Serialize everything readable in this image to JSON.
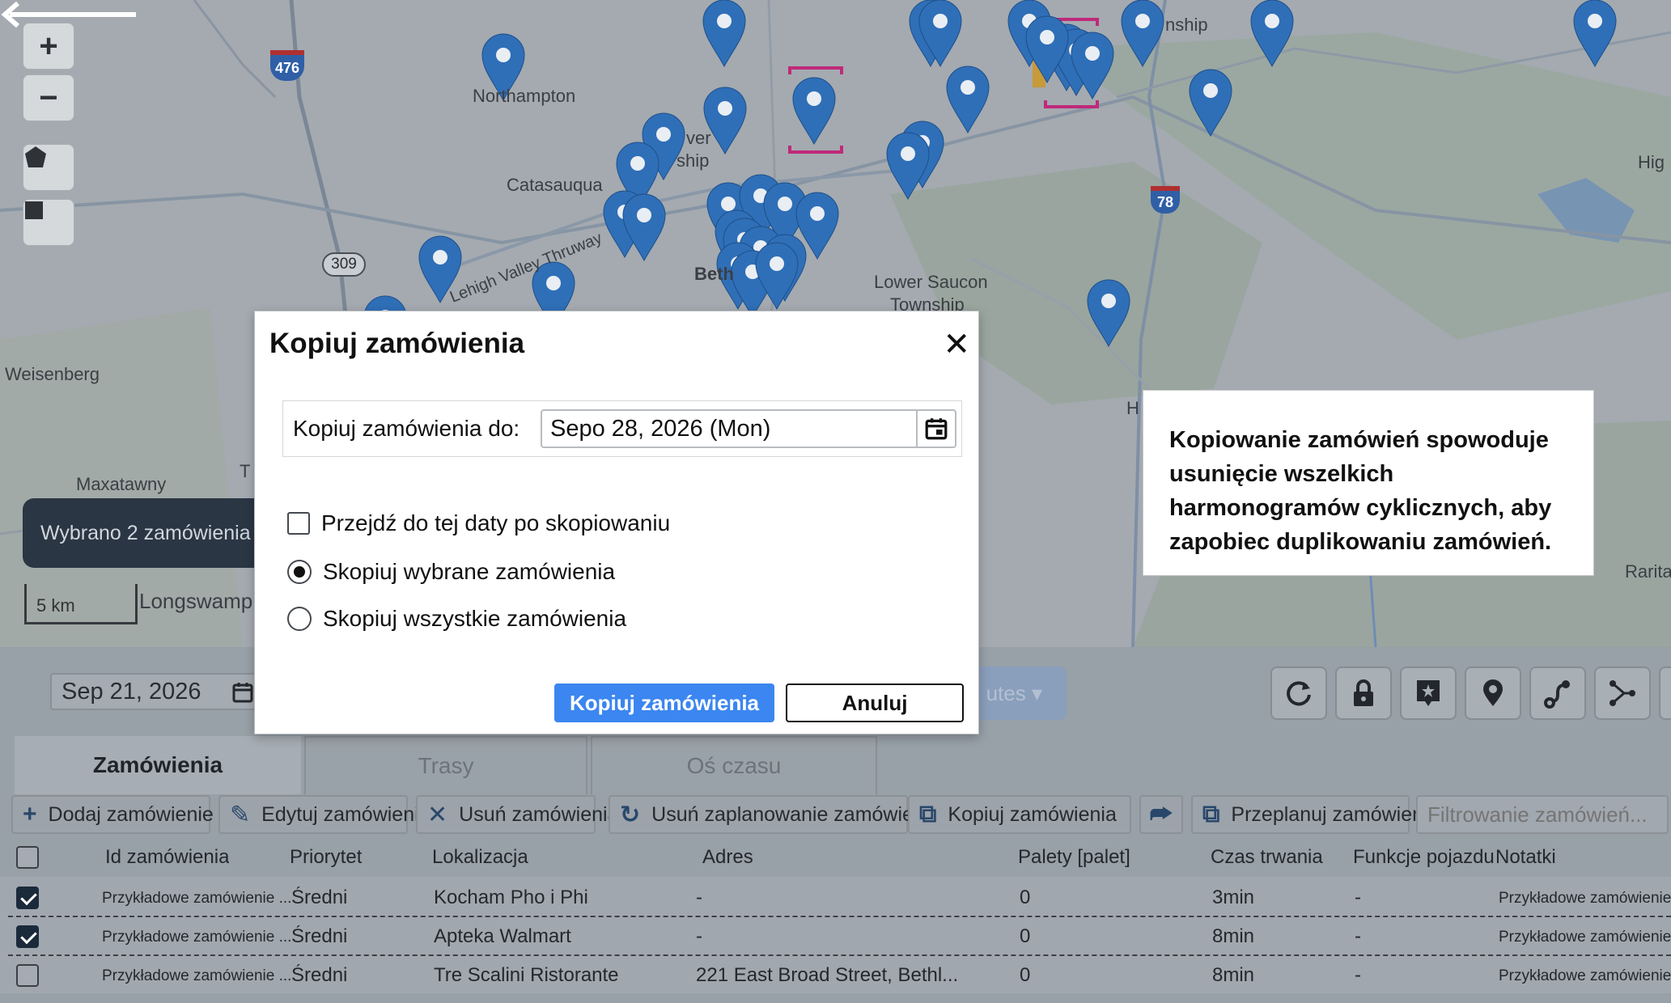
{
  "map": {
    "zoom_in": "+",
    "zoom_out": "−",
    "labels": {
      "northampton": "Northampton",
      "catasauqua": "Catasauqua",
      "hanover_ver": "ver",
      "hanover_ship": "ship",
      "weisenberg": "Weisenberg",
      "maxatawny": "Maxatawny",
      "longswamp": "Longswamp",
      "lower_saucon": "Lower Saucon",
      "township": "Township",
      "beth": "Beth",
      "thruway": "Lehigh Valley Thruway",
      "tatamy": "nship",
      "hig": "Hig",
      "rarita": "Rarita",
      "h": "H",
      "t": "T"
    },
    "highway_shields": [
      "476",
      "309",
      "78"
    ],
    "selection_pill": "Wybrano 2 zamówienia",
    "scale": "5 km"
  },
  "callout": {
    "text": "Kopiowanie zamówień spowoduje usunięcie wszelkich harmonogramów cyklicznych, aby zapobiec duplikowaniu zamówień."
  },
  "toolbar_top": {
    "date": "Sep 21, 2026",
    "ghost_button": "utes"
  },
  "tabs": [
    {
      "label": "Zamówienia",
      "active": true
    },
    {
      "label": "Trasy",
      "active": false
    },
    {
      "label": "Oś czasu",
      "active": false
    }
  ],
  "actions": {
    "add": "Dodaj zamówienie",
    "edit": "Edytuj zamówienia",
    "delete": "Usuń zamówienia",
    "unschedule": "Usuń zaplanowanie zamówień",
    "copy": "Kopiuj zamówienia",
    "reschedule": "Przeplanuj zamówienia",
    "filter_placeholder": "Filtrowanie zamówień..."
  },
  "table": {
    "headers": [
      "Id zamówienia",
      "Priorytet",
      "Lokalizacja",
      "Adres",
      "Palety [palet]",
      "Czas trwania",
      "Funkcje pojazdu",
      "Notatki"
    ],
    "rows": [
      {
        "checked": true,
        "id": "Przykładowe zamówienie ...",
        "priority": "Średni",
        "location": "Kocham Pho i Phi",
        "address": "-",
        "pallets": "0",
        "duration": "3min",
        "features": "-",
        "notes": "Przykładowe zamówienie"
      },
      {
        "checked": true,
        "id": "Przykładowe zamówienie ...",
        "priority": "Średni",
        "location": "Apteka Walmart",
        "address": "-",
        "pallets": "0",
        "duration": "8min",
        "features": "-",
        "notes": "Przykładowe zamówienie"
      },
      {
        "checked": false,
        "id": "Przykładowe zamówienie ...",
        "priority": "Średni",
        "location": "Tre Scalini Ristorante",
        "address": "221 East Broad Street, Bethl...",
        "pallets": "0",
        "duration": "8min",
        "features": "-",
        "notes": "Przykładowe zamówienie"
      }
    ]
  },
  "modal": {
    "title": "Kopiuj zamówienia",
    "close": "✕",
    "date_label": "Kopiuj zamówienia do:",
    "date_value": "Sepo 28, 2026 (Mon)",
    "option_goto": "Przejdź do tej daty po skopiowaniu",
    "goto_checked": false,
    "option_selected": "Skopiuj wybrane zamówienia",
    "option_all": "Skopiuj wszystkie zamówienia",
    "selected_option": "selected",
    "confirm": "Kopiuj zamówienia",
    "cancel": "Anuluj"
  },
  "colors": {
    "primary": "#3b86f0",
    "pin": "#2f6fb7",
    "selection_pill": "#2b3644",
    "selected_marker": "#c0297a"
  }
}
